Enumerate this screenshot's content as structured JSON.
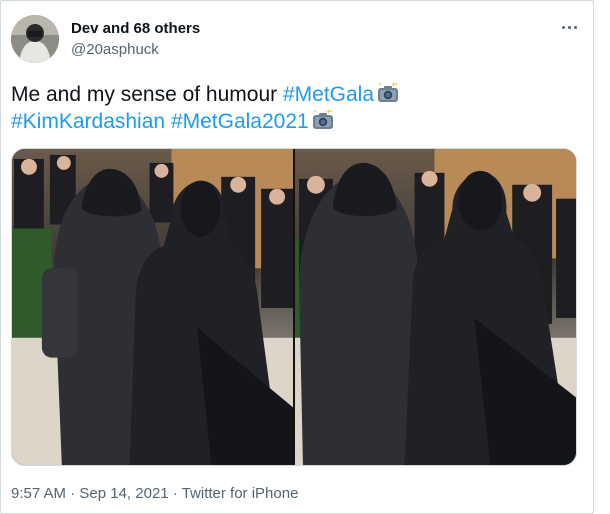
{
  "tweet": {
    "display_name": "Dev and 68 others",
    "handle": "@20asphuck",
    "text_plain": "Me and my sense of humour ",
    "hashtags": [
      "#MetGala",
      "#KimKardashian",
      "#MetGala2021"
    ],
    "emoji": "camera-with-flash",
    "time": "9:57 AM",
    "date": "Sep 14, 2021",
    "separator": " · ",
    "source": "Twitter for iPhone"
  },
  "media": [
    {
      "icon": "photo-metgala-left"
    },
    {
      "icon": "photo-metgala-right"
    }
  ],
  "colors": {
    "link": "#1d9bf0",
    "muted": "#536471",
    "text": "#0f1419",
    "border": "#cfd9de"
  }
}
